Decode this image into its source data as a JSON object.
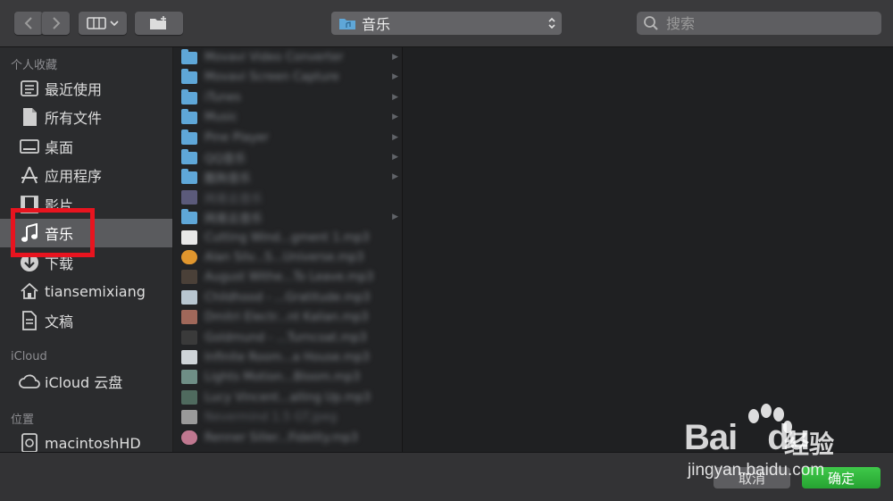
{
  "toolbar": {
    "back_icon": "chevron-left-icon",
    "forward_icon": "chevron-right-icon",
    "view_icon": "column-view-icon",
    "new_folder_icon": "new-folder-icon",
    "location": "音乐",
    "search_placeholder": "搜索"
  },
  "sidebar": {
    "favorites_header": "个人收藏",
    "favorites": [
      {
        "label": "最近使用",
        "icon": "recents-icon"
      },
      {
        "label": "所有文件",
        "icon": "all-files-icon"
      },
      {
        "label": "桌面",
        "icon": "desktop-icon"
      },
      {
        "label": "应用程序",
        "icon": "applications-icon"
      },
      {
        "label": "影片",
        "icon": "movies-icon"
      },
      {
        "label": "音乐",
        "icon": "music-note-icon",
        "selected": true
      },
      {
        "label": "下载",
        "icon": "downloads-icon"
      },
      {
        "label": "tiansemixiang",
        "icon": "home-icon"
      },
      {
        "label": "文稿",
        "icon": "documents-icon"
      }
    ],
    "icloud_header": "iCloud",
    "icloud": [
      {
        "label": "iCloud 云盘",
        "icon": "cloud-icon"
      }
    ],
    "locations_header": "位置",
    "locations": [
      {
        "label": "macintoshHD",
        "icon": "disk-icon"
      }
    ]
  },
  "file_list": [
    {
      "name": "Movavi Video Converter",
      "kind": "folder"
    },
    {
      "name": "Movavi Screen Capture",
      "kind": "folder"
    },
    {
      "name": "iTunes",
      "kind": "folder"
    },
    {
      "name": "Music",
      "kind": "folder"
    },
    {
      "name": "Pine Player",
      "kind": "folder"
    },
    {
      "name": "QQ音乐",
      "kind": "folder"
    },
    {
      "name": "酷狗音乐",
      "kind": "folder"
    },
    {
      "name": "网易云音乐",
      "kind": "app"
    },
    {
      "name": "网易云音乐",
      "kind": "folder"
    },
    {
      "name": "Cutting Wind...gment 1.mp3",
      "kind": "audio"
    },
    {
      "name": "Alan Silv...S...Universe.mp3",
      "kind": "audio"
    },
    {
      "name": "August Withe...To Leave.mp3",
      "kind": "audio"
    },
    {
      "name": "Childhood - ...Gratitude.mp3",
      "kind": "audio"
    },
    {
      "name": "Dmitri Electr...nt Kalian.mp3",
      "kind": "audio"
    },
    {
      "name": "Goldmund - ...Turncoat.mp3",
      "kind": "audio"
    },
    {
      "name": "Infinite Room...a House.mp3",
      "kind": "audio"
    },
    {
      "name": "Lights Motion...Bloom.mp3",
      "kind": "audio"
    },
    {
      "name": "Lucy Vincent...alling Up.mp3",
      "kind": "audio"
    },
    {
      "name": "Nevermind 1.5 GT.jpeg",
      "kind": "doc"
    },
    {
      "name": "Renner Siller...Fidelity.mp3",
      "kind": "audio"
    }
  ],
  "buttons": {
    "cancel": "取消",
    "ok": "确定"
  },
  "watermark": {
    "brand": "Bai",
    "brand2": "du",
    "product": "经验",
    "url": "jingyan.baidu.com"
  }
}
